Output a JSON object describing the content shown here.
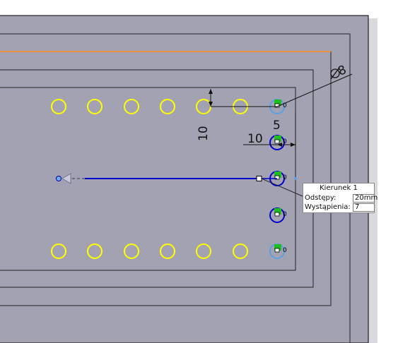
{
  "sketch": {
    "dimensions": {
      "diameter": "8",
      "vertical_offset": "10",
      "small_offset": "5",
      "horizontal_offset": "10"
    },
    "relation_glyph": "0",
    "colors": {
      "background": "#ffffff",
      "plate": "#a3a2b3",
      "border": "#222222",
      "edge_highlight": "#ff8c1a",
      "hole_outline": "#ffff00",
      "selected": "#0000cc",
      "relation_badge": "#22bb22"
    }
  },
  "pattern_panel": {
    "title": "Kierunek 1",
    "spacing_label": "Odstępy:",
    "spacing_value": "20mm",
    "instances_label": "Wystąpienia:",
    "instances_value": "7"
  }
}
